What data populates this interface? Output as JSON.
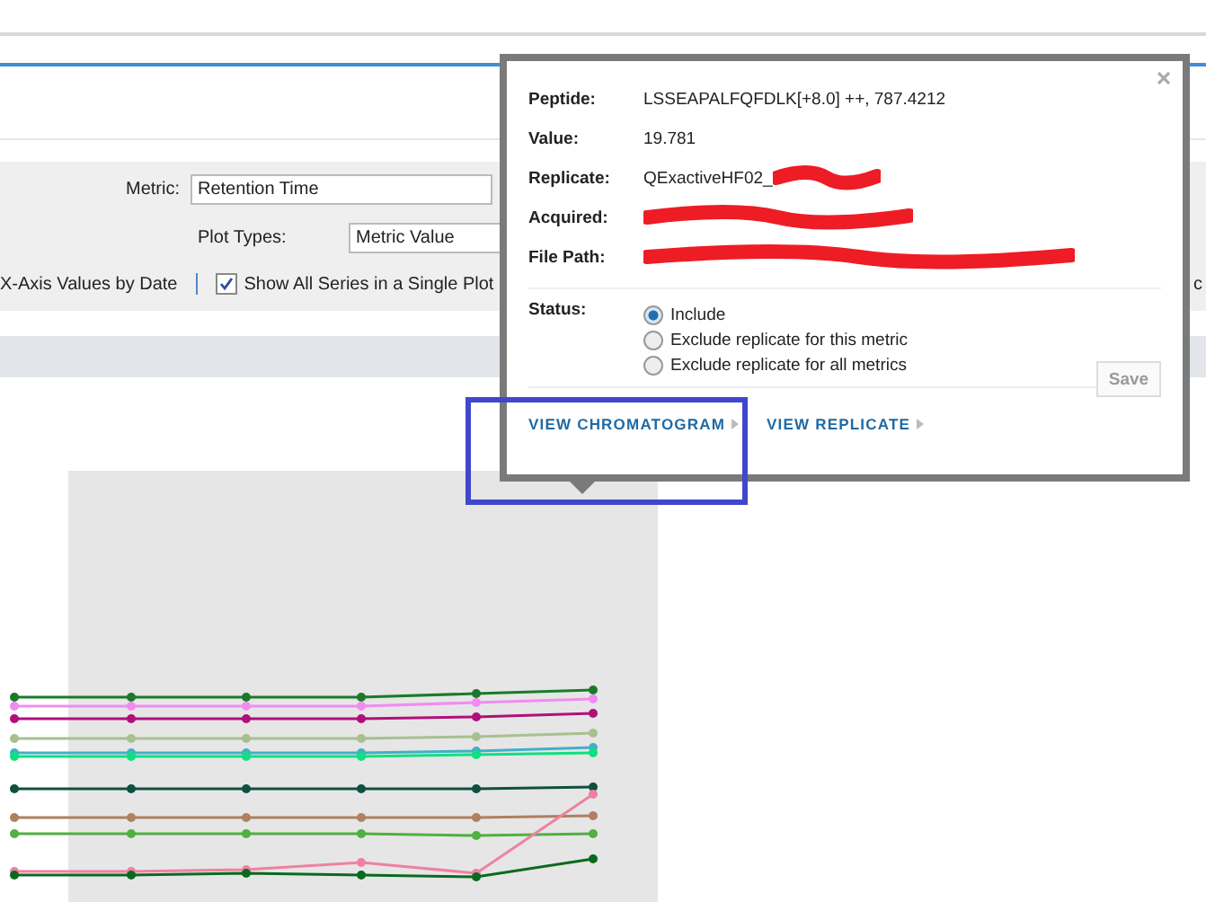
{
  "filters": {
    "metric_label": "Metric:",
    "metric_value": "Retention Time",
    "plot_types_label": "Plot Types:",
    "plot_types_value": "Metric Value"
  },
  "options": [
    {
      "kind": "text",
      "label": "X-Axis Values by Date"
    },
    {
      "kind": "checkbox",
      "label": "Show All Series in a Single Plot",
      "checked": true
    },
    {
      "kind": "text",
      "label": "c"
    }
  ],
  "popup": {
    "rows": [
      {
        "label": "Peptide:",
        "value": "LSSEAPALFQFDLK[+8.0] ++, 787.4212"
      },
      {
        "label": "Value:",
        "value": "19.781"
      },
      {
        "label": "Replicate:",
        "value": "QExactiveHF02_",
        "redacted": true
      },
      {
        "label": "Acquired:",
        "redacted": true
      },
      {
        "label": "File Path:",
        "redacted": true
      }
    ],
    "status_label": "Status:",
    "status_options": [
      {
        "label": "Include",
        "selected": true
      },
      {
        "label": "Exclude replicate for this metric",
        "selected": false
      },
      {
        "label": "Exclude replicate for all metrics",
        "selected": false
      }
    ],
    "save": {
      "label": "Save",
      "disabled": true
    },
    "links": [
      "VIEW CHROMATOGRAM",
      "VIEW REPLICATE"
    ]
  }
}
